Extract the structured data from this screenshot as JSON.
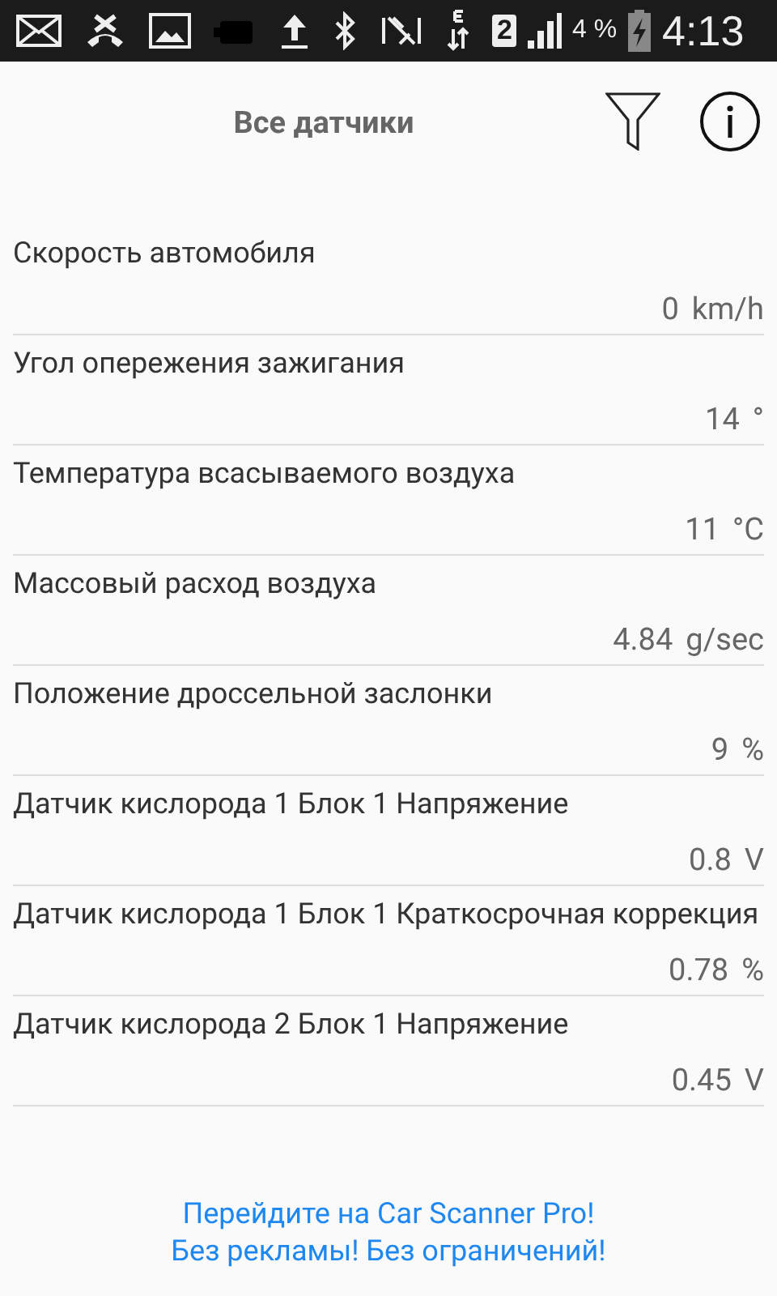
{
  "status_bar": {
    "sim_slot": "2",
    "battery_percent": "4 %",
    "time": "4:13"
  },
  "header": {
    "title": "Все датчики"
  },
  "sensors": [
    {
      "name": "Скорость автомобиля",
      "value": "0",
      "unit": "km/h"
    },
    {
      "name": "Угол опережения зажигания",
      "value": "14",
      "unit": "°"
    },
    {
      "name": "Температура всасываемого воздуха",
      "value": "11",
      "unit": "°C"
    },
    {
      "name": "Массовый расход воздуха",
      "value": "4.84",
      "unit": "g/sec"
    },
    {
      "name": "Положение дроссельной заслонки",
      "value": "9",
      "unit": "%"
    },
    {
      "name": "Датчик кислорода 1 Блок 1 Напряжение",
      "value": "0.8",
      "unit": "V"
    },
    {
      "name": "Датчик кислорода 1 Блок 1 Краткосрочная коррекция",
      "value": "0.78",
      "unit": "%"
    },
    {
      "name": "Датчик кислорода 2 Блок 1 Напряжение",
      "value": "0.45",
      "unit": "V"
    }
  ],
  "ad": {
    "lines": [
      "Перейдите на Car Scanner Pro!",
      "Без рекламы! Без ограничений!"
    ]
  }
}
